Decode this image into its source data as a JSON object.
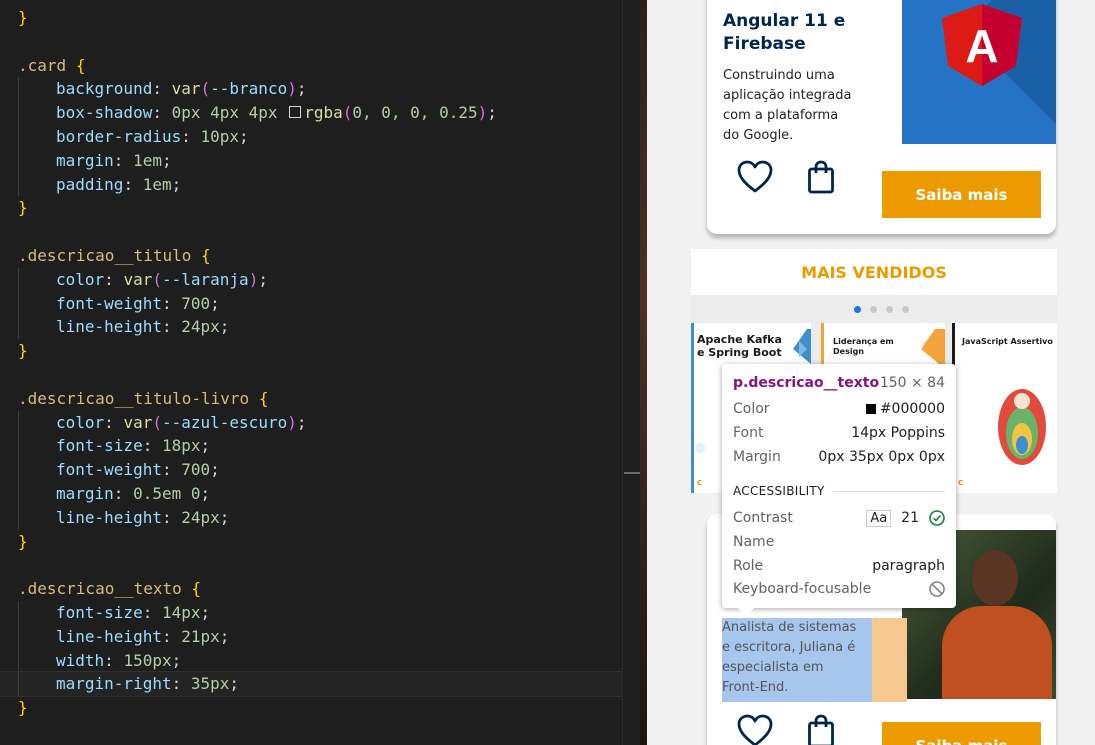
{
  "editor": {
    "lines": [
      {
        "type": "close"
      },
      {
        "type": "blank"
      },
      {
        "type": "rule",
        "selector": ".card"
      },
      {
        "type": "decl",
        "prop": "background",
        "kind": "var",
        "fn": "var",
        "arg": "--branco"
      },
      {
        "type": "shadow",
        "prop": "box-shadow",
        "pre": "0px 4px 4px",
        "fn": "rgba",
        "args": "0, 0, 0, 0.25"
      },
      {
        "type": "decl",
        "prop": "border-radius",
        "kind": "num",
        "value": "10px"
      },
      {
        "type": "decl",
        "prop": "margin",
        "kind": "num",
        "value": "1em"
      },
      {
        "type": "decl",
        "prop": "padding",
        "kind": "num",
        "value": "1em"
      },
      {
        "type": "close"
      },
      {
        "type": "blank"
      },
      {
        "type": "rule",
        "selector": ".descricao__titulo"
      },
      {
        "type": "decl",
        "prop": "color",
        "kind": "var",
        "fn": "var",
        "arg": "--laranja"
      },
      {
        "type": "decl",
        "prop": "font-weight",
        "kind": "num",
        "value": "700"
      },
      {
        "type": "decl",
        "prop": "line-height",
        "kind": "num",
        "value": "24px"
      },
      {
        "type": "close"
      },
      {
        "type": "blank"
      },
      {
        "type": "rule",
        "selector": ".descricao__titulo-livro"
      },
      {
        "type": "decl",
        "prop": "color",
        "kind": "var",
        "fn": "var",
        "arg": "--azul-escuro"
      },
      {
        "type": "decl",
        "prop": "font-size",
        "kind": "num",
        "value": "18px"
      },
      {
        "type": "decl",
        "prop": "font-weight",
        "kind": "num",
        "value": "700"
      },
      {
        "type": "decl",
        "prop": "margin",
        "kind": "num",
        "value": "0.5em 0"
      },
      {
        "type": "decl",
        "prop": "line-height",
        "kind": "num",
        "value": "24px"
      },
      {
        "type": "close"
      },
      {
        "type": "blank"
      },
      {
        "type": "rule",
        "selector": ".descricao__texto"
      },
      {
        "type": "decl",
        "prop": "font-size",
        "kind": "num",
        "value": "14px"
      },
      {
        "type": "decl",
        "prop": "line-height",
        "kind": "num",
        "value": "21px"
      },
      {
        "type": "decl",
        "prop": "width",
        "kind": "num",
        "value": "150px"
      },
      {
        "type": "decl",
        "prop": "margin-right",
        "kind": "num",
        "value": "35px",
        "active": true
      },
      {
        "type": "close"
      }
    ]
  },
  "preview": {
    "card1": {
      "title": "Angular 11 e Firebase",
      "title_line1": "Angular 11 e",
      "title_line2": "Firebase",
      "description_lines": [
        "Construindo uma",
        "aplicação integrada",
        "com a plataforma",
        "do Google."
      ],
      "logo_letter": "A",
      "button": "Saiba mais"
    },
    "section_title": "MAIS VENDIDOS",
    "carousel": {
      "dots": 4,
      "active_dot": 0,
      "books": [
        {
          "title_lines": [
            "Apache Kafka",
            "e Spring Boot"
          ],
          "accent": "#3d8fd1"
        },
        {
          "title_lines": [
            "Liderança em",
            "Design"
          ],
          "accent": "#f2a33a"
        },
        {
          "title_lines": [
            "JavaScript Assertivo"
          ],
          "accent": "#e24b3b"
        }
      ]
    },
    "card2": {
      "description_lines": [
        "Analista de sistemas",
        "e escritora, Juliana é",
        "especialista em",
        "Front-End."
      ],
      "button": "Saiba mais"
    }
  },
  "tooltip": {
    "selector": "p.descricao__texto",
    "size": "150 × 84",
    "rows": [
      {
        "label": "Color",
        "value": "#000000"
      },
      {
        "label": "Font",
        "value": "14px Poppins"
      },
      {
        "label": "Margin",
        "value": "0px 35px 0px 0px"
      }
    ],
    "accessibility_heading": "ACCESSIBILITY",
    "contrast_label": "Contrast",
    "contrast_badge": "Aa",
    "contrast_value": "21",
    "name_label": "Name",
    "role_label": "Role",
    "role_value": "paragraph",
    "keyboard_label": "Keyboard-focusable"
  },
  "colors": {
    "orange": "#eb9b00",
    "dark_blue": "#00264d",
    "highlight_content": "#a7c6ed",
    "highlight_margin": "#f6c890"
  }
}
